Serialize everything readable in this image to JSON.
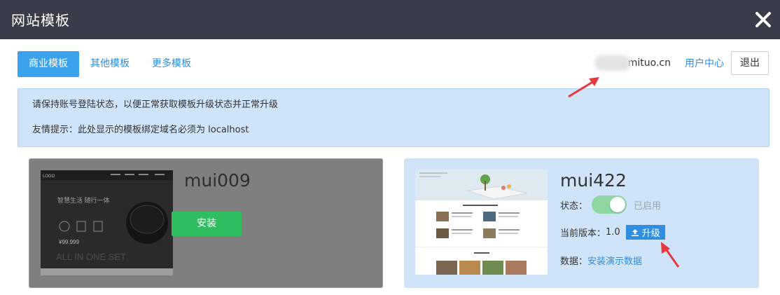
{
  "dialog": {
    "title": "网站模板"
  },
  "tabs": [
    "商业模板",
    "其他模板",
    "更多模板"
  ],
  "account": {
    "email_visible": "mituo.cn",
    "user_center": "用户中心",
    "logout": "退出"
  },
  "notice": {
    "line1": "请保持账号登陆状态，以便正常获取模板升级状态并正常升级",
    "line2": "友情提示：此处显示的模板绑定域名必须为 localhost"
  },
  "templates": [
    {
      "name": "mui009",
      "install_label": "安装",
      "thumb_slogan": "智慧生活 随行一体",
      "thumb_price": "¥99.999",
      "thumb_tagline": "ALL IN ONE SET",
      "thumb_logo": "LOGO"
    },
    {
      "name": "mui422",
      "status_label": "状态：",
      "status_value": "已启用",
      "version_label": "当前版本：",
      "version_value": "1.0",
      "upgrade_label": "升级",
      "data_label": "数据：",
      "data_link": "安装演示数据"
    }
  ],
  "colors": {
    "titlebar": "#393d49",
    "accent": "#2f8ee0",
    "install_green": "#2ebd5f",
    "notice_bg": "#cfe4f8",
    "arrow_red": "#e8383d"
  }
}
